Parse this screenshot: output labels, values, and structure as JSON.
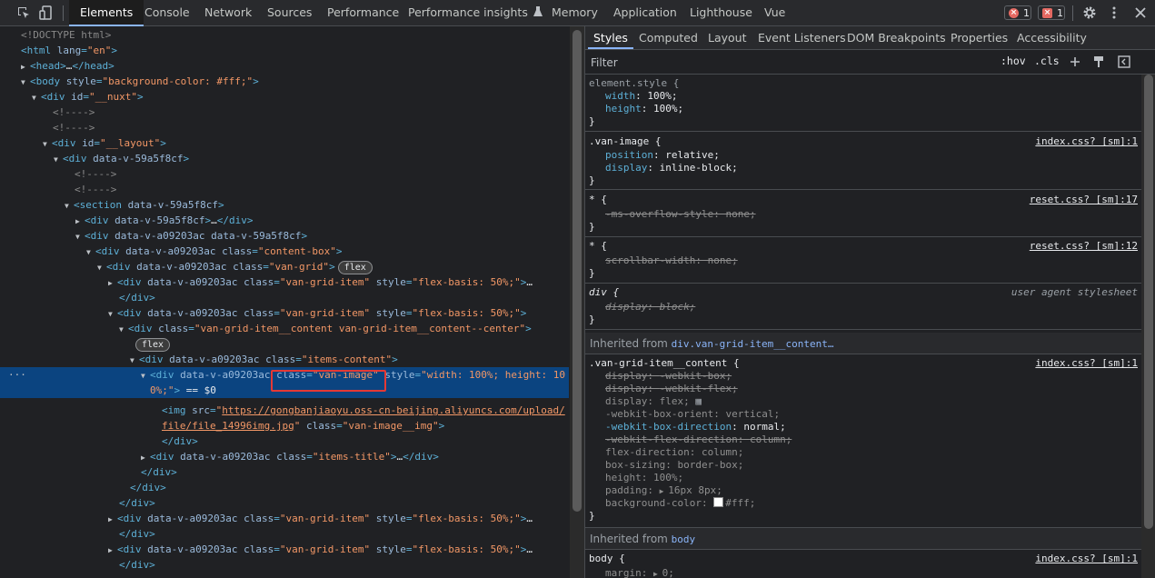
{
  "toolbar": {
    "tabs": [
      "Elements",
      "Console",
      "Network",
      "Sources",
      "Performance",
      "Performance insights",
      "Memory",
      "Application",
      "Lighthouse",
      "Vue"
    ],
    "errors_count": "1",
    "issues_count": "1"
  },
  "tree": {
    "lines": [
      {
        "t": "<!DOCTYPE html>"
      },
      {
        "t": "<html lang=\"en\">"
      },
      {
        "t": "<head>…</head>"
      },
      {
        "t": "<body style=\"background-color: #fff;\">"
      },
      {
        "t": "<div id=\"__nuxt\">"
      },
      {
        "t": "<!---->"
      },
      {
        "t": "<!---->"
      },
      {
        "t": "<div id=\"__layout\">"
      },
      {
        "t": "<div data-v-59a5f8cf>"
      },
      {
        "t": "<!---->"
      },
      {
        "t": "<!---->"
      },
      {
        "t": "<section data-v-59a5f8cf>"
      },
      {
        "t": "<div data-v-59a5f8cf>…</div>"
      },
      {
        "t": "<div data-v-a09203ac data-v-59a5f8cf>"
      },
      {
        "t": "<div data-v-a09203ac class=\"content-box\">"
      },
      {
        "t": "<div data-v-a09203ac class=\"van-grid\">"
      },
      {
        "t": "<div data-v-a09203ac class=\"van-grid-item\" style=\"flex-basis: 50%;\">…"
      },
      {
        "t": "</div>"
      },
      {
        "t": "<div data-v-a09203ac class=\"van-grid-item\" style=\"flex-basis: 50%;\">"
      },
      {
        "t": "<div class=\"van-grid-item__content van-grid-item__content--center\">"
      },
      {
        "t": ""
      },
      {
        "t": "<div data-v-a09203ac class=\"items-content\">"
      },
      {
        "t": "<div data-v-a09203ac class=\"van-image\" style=\"width: 100%; height: 10"
      },
      {
        "t": "0%;\"> == $0"
      },
      {
        "t": "<img src=\"https://gongbanjiaoyu.oss-cn-beijing.aliyuncs.com/upload/"
      },
      {
        "t": "file/file_14996img.jpg\" class=\"van-image__img\">"
      },
      {
        "t": "</div>"
      },
      {
        "t": "<div data-v-a09203ac class=\"items-title\">…</div>"
      },
      {
        "t": "</div>"
      },
      {
        "t": "</div>"
      },
      {
        "t": "</div>"
      },
      {
        "t": "<div data-v-a09203ac class=\"van-grid-item\" style=\"flex-basis: 50%;\">…"
      },
      {
        "t": "</div>"
      },
      {
        "t": "<div data-v-a09203ac class=\"van-grid-item\" style=\"flex-basis: 50%;\">…"
      },
      {
        "t": "</div>"
      }
    ],
    "flex_badge": "flex",
    "ellipsis": "…",
    "img_url_1": "https://gongbanjiaoyu.oss-cn-beijing.aliyuncs.com/upload/",
    "img_url_2": "file/file_14996img.jpg"
  },
  "styles_tabs": [
    "Styles",
    "Computed",
    "Layout",
    "Event Listeners",
    "DOM Breakpoints",
    "Properties",
    "Accessibility"
  ],
  "filter": {
    "placeholder": "Filter",
    "hov": ":hov",
    "cls": ".cls"
  },
  "rules": {
    "element_style": {
      "selector": "element.style {",
      "width": "100%;",
      "height": "100%;"
    },
    "van_image": {
      "selector": ".van-image {",
      "source": "index.css? [sm]:1",
      "position": "relative;",
      "display": "inline-block;"
    },
    "reset1": {
      "selector": "* {",
      "source": "reset.css? [sm]:17",
      "prop": "-ms-overflow-style: none;"
    },
    "reset2": {
      "selector": "* {",
      "source": "reset.css? [sm]:12",
      "prop": "scrollbar-width: none;"
    },
    "div_ua": {
      "selector": "div {",
      "source": "user agent stylesheet",
      "prop": "display: block;"
    },
    "inherited1": {
      "label": "Inherited from ",
      "link": "div.van-grid-item__content…"
    },
    "grid_content": {
      "selector": ".van-grid-item__content {",
      "source": "index.css? [sm]:1",
      "props": [
        {
          "n": "display",
          "v": "-webkit-box;",
          "state": "strike"
        },
        {
          "n": "display",
          "v": "-webkit-flex;",
          "state": "strike"
        },
        {
          "n": "display",
          "v": "flex;",
          "state": "dim"
        },
        {
          "n": "-webkit-box-orient",
          "v": "vertical;",
          "state": "dim"
        },
        {
          "n": "-webkit-box-direction",
          "v": "normal;",
          "state": "on"
        },
        {
          "n": "-webkit-flex-direction",
          "v": "column;",
          "state": "strike"
        },
        {
          "n": "flex-direction",
          "v": "column;",
          "state": "dim"
        },
        {
          "n": "box-sizing",
          "v": "border-box;",
          "state": "dim"
        },
        {
          "n": "height",
          "v": "100%;",
          "state": "dim"
        },
        {
          "n": "padding",
          "v": "16px 8px;",
          "state": "dim"
        },
        {
          "n": "background-color",
          "v": "#fff;",
          "state": "dim"
        }
      ]
    },
    "inherited2": {
      "label": "Inherited from ",
      "link": "body"
    },
    "body_rule": {
      "selector": "body {",
      "source": "index.css? [sm]:1",
      "prop_n": "margin",
      "prop_v": "0;"
    }
  },
  "colors": {
    "accent": "#8ab4f8",
    "selection": "#0b4480",
    "error": "#e46962"
  }
}
